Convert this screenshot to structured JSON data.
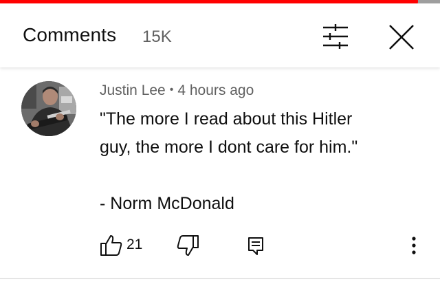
{
  "video_progress": {
    "fraction": 0.933,
    "played_color": "#ff0000"
  },
  "header": {
    "title": "Comments",
    "count": "15K",
    "icons": {
      "filter": "sort-filter-icon",
      "close": "close-icon"
    }
  },
  "comment": {
    "author": "Justin Lee",
    "separator": "•",
    "time": "4 hours ago",
    "lines": [
      "\"The more I read about this Hitler",
      "guy, the more I dont care for him.\"",
      "- Norm McDonald"
    ],
    "likes": "21",
    "icons": {
      "like": "thumbs-up-icon",
      "dislike": "thumbs-down-icon",
      "reply": "reply-comment-icon",
      "more": "more-vertical-icon"
    }
  }
}
